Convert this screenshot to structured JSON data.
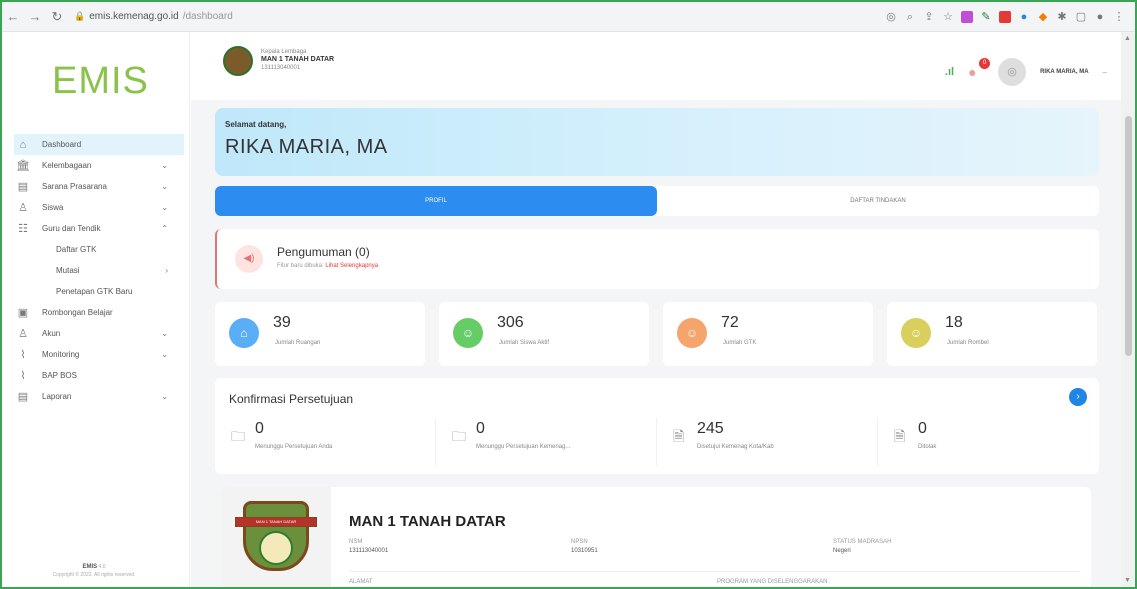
{
  "browser": {
    "url_domain": "emis.kemenag.go.id",
    "url_path": "/dashboard"
  },
  "sidebar": {
    "logo": "EMIS",
    "items": [
      {
        "label": "Dashboard",
        "icon": "home-icon",
        "active": true,
        "chevron": ""
      },
      {
        "label": "Kelembagaan",
        "icon": "institution-icon",
        "chevron": "⌄"
      },
      {
        "label": "Sarana Prasarana",
        "icon": "building-icon",
        "chevron": "⌄"
      },
      {
        "label": "Siswa",
        "icon": "student-icon",
        "chevron": "⌄"
      },
      {
        "label": "Guru dan Tendik",
        "icon": "teacher-icon",
        "chevron": "⌃"
      },
      {
        "label": "Daftar GTK",
        "sub": true,
        "chevron": ""
      },
      {
        "label": "Mutasi",
        "sub": true,
        "chevron": "›"
      },
      {
        "label": "Penetapan GTK Baru",
        "sub": true,
        "chevron": ""
      },
      {
        "label": "Rombongan Belajar",
        "icon": "class-icon",
        "chevron": ""
      },
      {
        "label": "Akun",
        "icon": "user-icon",
        "chevron": "⌄"
      },
      {
        "label": "Monitoring",
        "icon": "chart-icon",
        "chevron": "⌄"
      },
      {
        "label": "BAP BOS",
        "icon": "chart-icon",
        "chevron": ""
      },
      {
        "label": "Laporan",
        "icon": "report-icon",
        "chevron": "⌄"
      }
    ],
    "footer_app": "EMIS",
    "footer_version": "4.0",
    "footer_copyright": "Copyright © 2022. All rights reserved."
  },
  "header": {
    "institution_role": "Kepala Lembaga",
    "institution_name": "MAN 1 TANAH DATAR",
    "institution_id": "131113040001",
    "notification_count": "0",
    "user_name": "RIKA MARIA, MA"
  },
  "welcome": {
    "greeting": "Selamat datang,",
    "name": "RIKA MARIA, MA"
  },
  "tabs": [
    {
      "label": "PROFIL"
    },
    {
      "label": "DAFTAR TINDAKAN"
    }
  ],
  "announcement": {
    "title": "Pengumuman (0)",
    "text": "Fitur baru dibuka:",
    "link": "Lihat Selengkapnya"
  },
  "stats": [
    {
      "value": "39",
      "label": "Jumlah Ruangan",
      "color": "#5aaef5"
    },
    {
      "value": "306",
      "label": "Jumlah Siswa Aktif",
      "color": "#66cc66"
    },
    {
      "value": "72",
      "label": "Jumlah GTK",
      "color": "#f5a56b"
    },
    {
      "value": "18",
      "label": "Jumlah Rombel",
      "color": "#d8cf5c"
    }
  ],
  "konfirmasi": {
    "title": "Konfirmasi Persetujuan",
    "items": [
      {
        "value": "0",
        "label": "Menunggu Persetujuan Anda"
      },
      {
        "value": "0",
        "label": "Menunggu Persetujuan Kemenag..."
      },
      {
        "value": "245",
        "label": "Disetujui Kemenag Kota/Kab"
      },
      {
        "value": "0",
        "label": "Ditolak"
      }
    ]
  },
  "profile": {
    "name": "MAN 1 TANAH DATAR",
    "emblem_text": "MAN 1 TANAH DATAR",
    "nsm_label": "NSM",
    "nsm_value": "131113040001",
    "npsn_label": "NPSN",
    "npsn_value": "10310951",
    "status_label": "STATUS MADRASAH",
    "status_value": "Negeri",
    "alamat_label": "ALAMAT",
    "program_label": "PROGRAM YANG DISELENGGARAKAN"
  }
}
